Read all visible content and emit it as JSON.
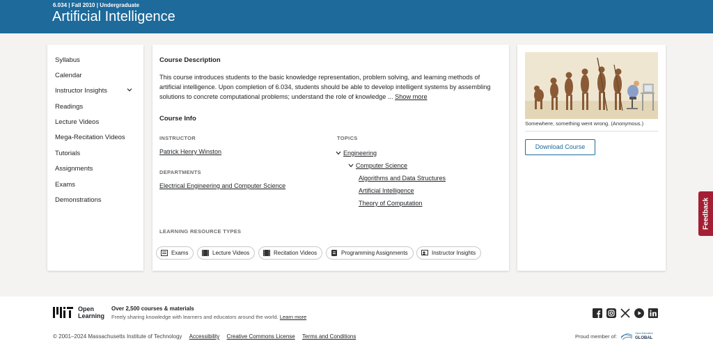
{
  "header": {
    "meta": "6.034 | Fall 2010 | Undergraduate",
    "title": "Artificial Intelligence"
  },
  "sidebar": {
    "items": [
      {
        "label": "Syllabus"
      },
      {
        "label": "Calendar"
      },
      {
        "label": "Instructor Insights",
        "icon": "chevron-down-icon"
      },
      {
        "label": "Readings"
      },
      {
        "label": "Lecture Videos"
      },
      {
        "label": "Mega-Recitation Videos"
      },
      {
        "label": "Tutorials"
      },
      {
        "label": "Assignments"
      },
      {
        "label": "Exams"
      },
      {
        "label": "Demonstrations"
      }
    ]
  },
  "main": {
    "description_heading": "Course Description",
    "description": "This course introduces students to the basic knowledge representation, problem solving, and learning methods of artificial intelligence. Upon completion of 6.034, students should be able to develop intelligent systems by assembling solutions to concrete computational problems; understand the role of knowledge ...",
    "show_more": "Show more",
    "info_heading": "Course Info",
    "instructor_label": "INSTRUCTOR",
    "instructor": "Patrick Henry Winston",
    "departments_label": "DEPARTMENTS",
    "department": "Electrical Engineering and Computer Science",
    "topics_label": "TOPICS",
    "topics": {
      "level1": "Engineering",
      "level2": "Computer Science",
      "level3": [
        "Algorithms and Data Structures",
        "Artificial Intelligence",
        "Theory of Computation"
      ]
    },
    "resources_label": "LEARNING RESOURCE TYPES",
    "resources": [
      {
        "label": "Exams",
        "icon": "exam-icon"
      },
      {
        "label": "Lecture Videos",
        "icon": "film-icon"
      },
      {
        "label": "Recitation Videos",
        "icon": "film-icon"
      },
      {
        "label": "Programming Assignments",
        "icon": "assignment-icon"
      },
      {
        "label": "Instructor Insights",
        "icon": "instructor-icon"
      }
    ]
  },
  "right": {
    "image_caption": "Somewhere, something went wrong. (Anonymous.)",
    "download_label": "Download Course"
  },
  "feedback_label": "Feedback",
  "footer": {
    "logo_text_1": "Open",
    "logo_text_2": "Learning",
    "courses_count": "Over 2,500 courses & materials",
    "tagline": "Freely sharing knowledge with learners and educators around the world.",
    "learn_more": "Learn more",
    "copyright": "© 2001–2024 Massachusetts Institute of Technology",
    "links": [
      "Accessibility",
      "Creative Commons License",
      "Terms and Conditions"
    ],
    "proud_member": "Proud member of:",
    "oeg_small": "Open Education",
    "oeg_big": "GLOBAL",
    "socials": [
      "facebook-icon",
      "instagram-icon",
      "x-icon",
      "youtube-icon",
      "linkedin-icon"
    ]
  },
  "colors": {
    "brand_blue": "#1d6a9b",
    "feedback_red": "#a31f34"
  }
}
